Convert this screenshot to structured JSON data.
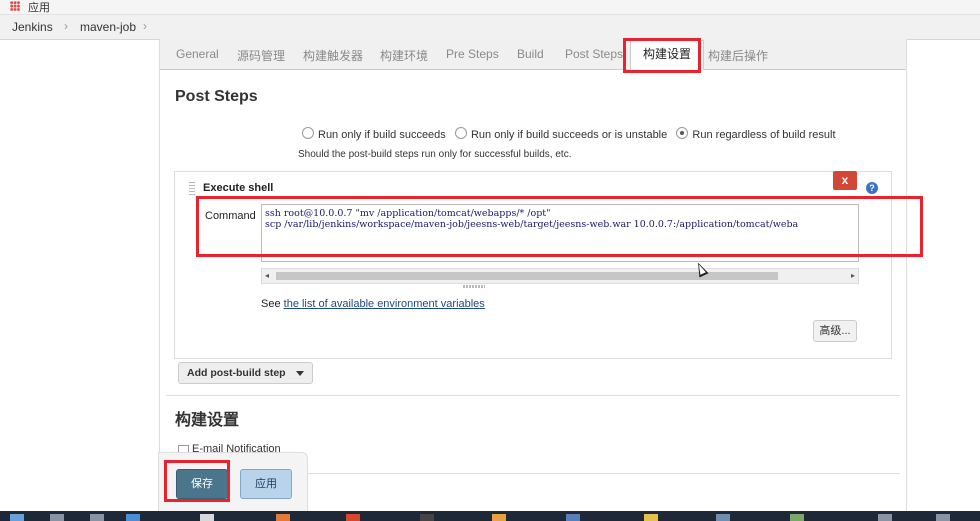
{
  "bookmarks_bar": {
    "apps_label": "应用"
  },
  "breadcrumb": {
    "items": [
      "Jenkins",
      "maven-job"
    ]
  },
  "tabs": [
    "General",
    "源码管理",
    "构建触发器",
    "构建环境",
    "Pre Steps",
    "Build",
    "Post Steps",
    "构建设置",
    "构建后操作"
  ],
  "active_tab": "构建设置",
  "post_steps": {
    "title": "Post Steps",
    "options": [
      {
        "label": "Run only if build succeeds",
        "checked": false
      },
      {
        "label": "Run only if build succeeds or is unstable",
        "checked": false
      },
      {
        "label": "Run regardless of build result",
        "checked": true
      }
    ],
    "hint": "Should the post-build steps run only for successful builds, etc."
  },
  "execute_shell": {
    "title": "Execute shell",
    "close_label": "x",
    "help_label": "?",
    "command_label": "Command",
    "command_lines": [
      "ssh root@10.0.0.7 \"mv /application/tomcat/webapps/* /opt\"",
      "scp /var/lib/jenkins/workspace/maven-job/jeesns-web/target/jeesns-web.war 10.0.0.7:/application/tomcat/weba"
    ],
    "see_prefix": "See ",
    "see_link": "the list of available environment variables",
    "advanced_label": "高级..."
  },
  "add_step_label": "Add post-build step",
  "build_settings": {
    "title": "构建设置",
    "email_label": "E-mail Notification"
  },
  "buttons": {
    "save": "保存",
    "apply": "应用"
  },
  "colors": {
    "highlight": "#e8232f",
    "save_bg": "#4b758b",
    "apply_bg": "#b8d3ea"
  }
}
